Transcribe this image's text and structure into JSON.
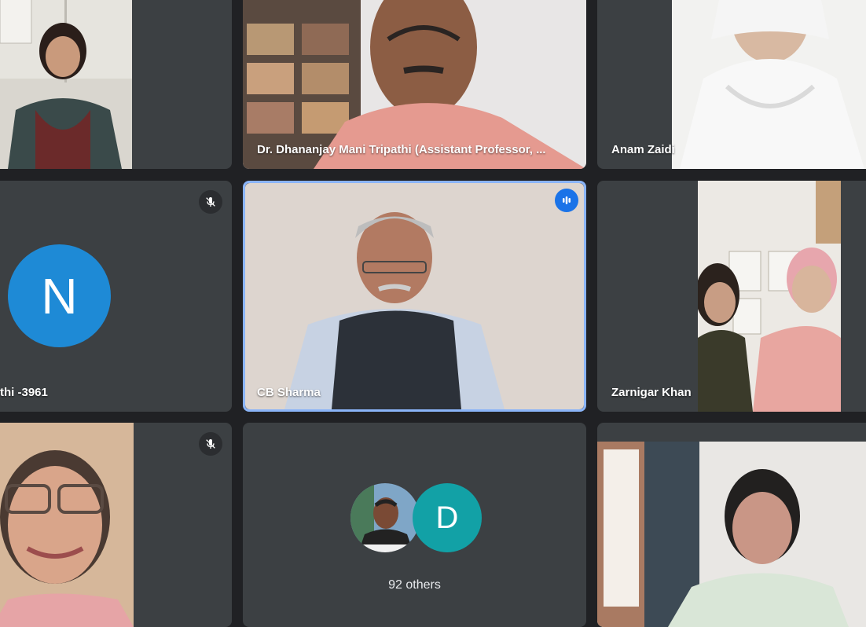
{
  "tiles": {
    "top_left": {
      "name": ""
    },
    "top_center": {
      "name": "Dr. Dhananjay Mani Tripathi (Assistant Professor, ..."
    },
    "top_right": {
      "name": "Anam Zaidi"
    },
    "mid_left": {
      "name": "thi -3961",
      "avatar_letter": "N",
      "avatar_color": "#1e8ad6",
      "muted": true
    },
    "mid_center": {
      "name": "CB Sharma",
      "speaking": true
    },
    "mid_right": {
      "name": "Zarnigar Khan"
    },
    "bottom_left": {
      "name": "",
      "muted": true
    },
    "bottom_center": {
      "others_label": "92 others",
      "avatar_letter": "D",
      "avatar_color": "#12a1a6"
    },
    "bottom_right": {
      "name": ""
    }
  },
  "colors": {
    "tile_bg": "#3c4043",
    "page_bg": "#202124",
    "speaking_border": "#8ab4f8"
  }
}
